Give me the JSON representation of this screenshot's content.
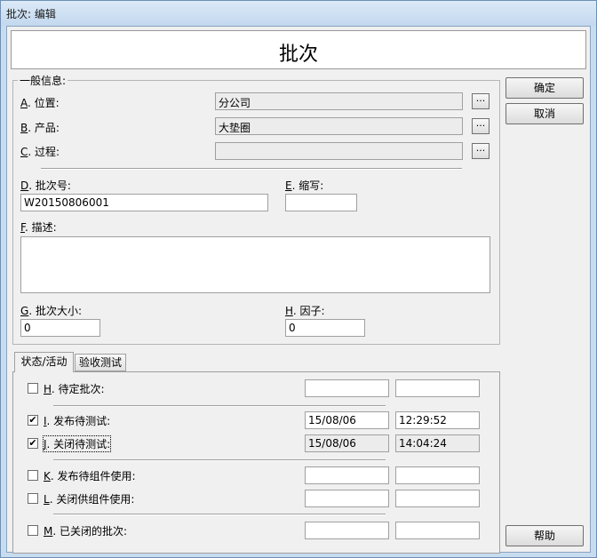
{
  "window": {
    "title": "批次: 编辑"
  },
  "header": {
    "title": "批次"
  },
  "buttons": {
    "ok": "确定",
    "cancel": "取消",
    "help": "帮助",
    "ellipsis": "..."
  },
  "general": {
    "legend": "一般信息:",
    "location": {
      "key": "A",
      "label": ". 位置:",
      "value": "分公司"
    },
    "product": {
      "key": "B",
      "label": ". 产品:",
      "value": "大垫圈"
    },
    "process": {
      "key": "C",
      "label": ". 过程:",
      "value": ""
    },
    "batch_no": {
      "key": "D",
      "label": ". 批次号:",
      "value": "W20150806001"
    },
    "abbr": {
      "key": "E",
      "label": ". 缩写:",
      "value": ""
    },
    "desc": {
      "key": "F",
      "label": ". 描述:",
      "value": ""
    },
    "batch_size": {
      "key": "G",
      "label": ". 批次大小:",
      "value": "0"
    },
    "factor": {
      "key": "H",
      "label": ". 因子:",
      "value": "0"
    }
  },
  "tabs": {
    "status": "状态/活动",
    "acceptance": "验收测试"
  },
  "status": {
    "pending": {
      "key": "H",
      "label": ". 待定批次:",
      "checked": false,
      "date": "",
      "time": ""
    },
    "release_test": {
      "key": "I",
      "label": ". 发布待测试:",
      "checked": true,
      "date": "15/08/06",
      "time": "12:29:52"
    },
    "close_test": {
      "key": "J",
      "label": ". 关闭待测试:",
      "checked": true,
      "date": "15/08/06",
      "time": "14:04:24"
    },
    "release_component": {
      "key": "K",
      "label": ". 发布待组件使用:",
      "checked": false,
      "date": "",
      "time": ""
    },
    "close_component": {
      "key": "L",
      "label": ". 关闭供组件使用:",
      "checked": false,
      "date": "",
      "time": ""
    },
    "closed_batch": {
      "key": "M",
      "label": ". 已关闭的批次:",
      "checked": false,
      "date": "",
      "time": ""
    }
  },
  "check_mark": "✔"
}
